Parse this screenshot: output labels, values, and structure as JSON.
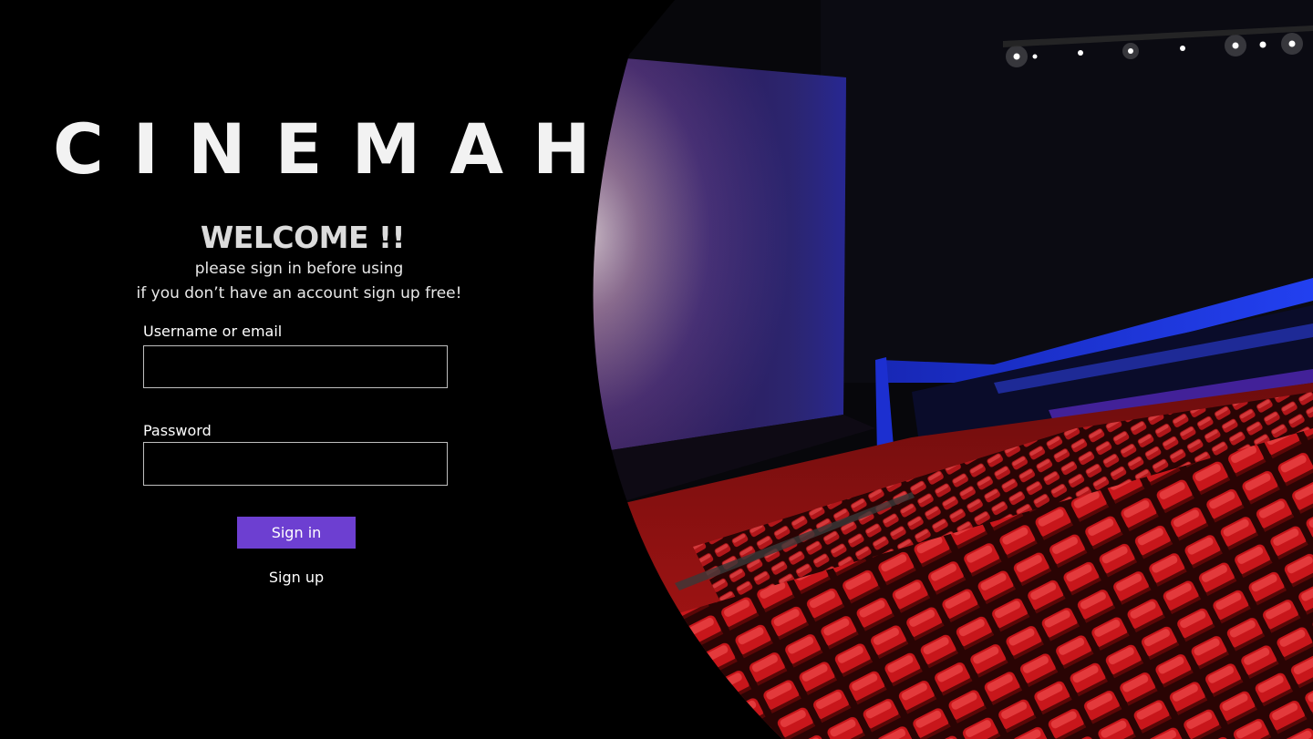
{
  "brand": {
    "name": "CINEMAH"
  },
  "intro": {
    "heading": "WELCOME !!",
    "line1": "please sign in before using",
    "line2": "if you don’t have an account sign up free!"
  },
  "form": {
    "username_label": "Username or email",
    "username_value": "",
    "password_label": "Password",
    "password_value": "",
    "signin_label": "Sign in",
    "signup_label": "Sign up"
  },
  "colors": {
    "background": "#000000",
    "accent": "#6d3fd1",
    "text": "#ffffff",
    "input_border": "#bfbfbf"
  }
}
